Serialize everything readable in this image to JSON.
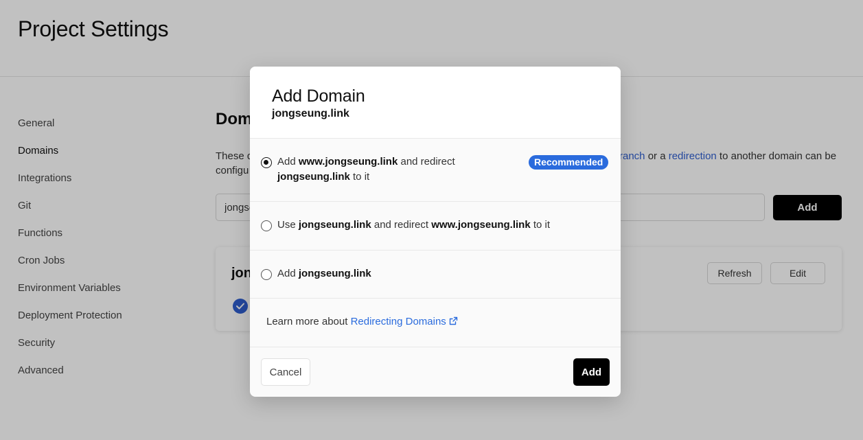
{
  "page": {
    "title": "Project Settings"
  },
  "sidebar": {
    "items": [
      {
        "label": "General"
      },
      {
        "label": "Domains"
      },
      {
        "label": "Integrations"
      },
      {
        "label": "Git"
      },
      {
        "label": "Functions"
      },
      {
        "label": "Cron Jobs"
      },
      {
        "label": "Environment Variables"
      },
      {
        "label": "Deployment Protection"
      },
      {
        "label": "Security"
      },
      {
        "label": "Advanced"
      }
    ],
    "active": "Domains"
  },
  "main": {
    "section_title_visible": "Dom",
    "desc_left_line1": "These d",
    "desc_left_line2": "configu",
    "desc_right_link1": "ranch",
    "desc_right_mid": " or a ",
    "desc_right_link2": "redirection",
    "desc_right_tail": " to another domain can be",
    "input_value": "jongse",
    "add_button": "Add",
    "card": {
      "domain_visible": "jon",
      "refresh_button": "Refresh",
      "edit_button": "Edit"
    }
  },
  "modal": {
    "title": "Add Domain",
    "subtitle": "jongseung.link",
    "options": [
      {
        "selected": true,
        "prefix": "Add ",
        "bold1": "www.jongseung.link",
        "mid": " and redirect",
        "bold2": "jongseung.link",
        "suffix": " to it",
        "badge": "Recommended"
      },
      {
        "selected": false,
        "prefix": "Use ",
        "bold1": "jongseung.link",
        "mid": " and redirect ",
        "bold2": "www.jongseung.link",
        "suffix": " to it"
      },
      {
        "selected": false,
        "prefix": "Add ",
        "bold1": "jongseung.link"
      }
    ],
    "learn_more_prefix": "Learn more about ",
    "learn_more_link": "Redirecting Domains",
    "cancel_button": "Cancel",
    "add_button": "Add"
  },
  "colors": {
    "accent_blue": "#2a6bdd",
    "primary_button": "#000000",
    "overlay": "rgba(0,0,0,0.245)"
  }
}
